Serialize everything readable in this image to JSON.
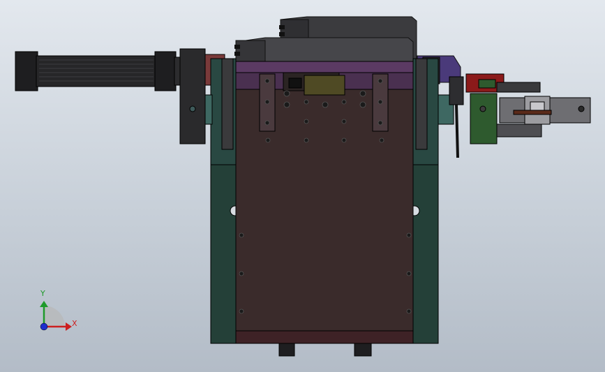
{
  "triad": {
    "x_label": "X",
    "y_label": "Y",
    "colors": {
      "x": "#cc1f1f",
      "y": "#1f9a2a",
      "z": "#1f2fcc"
    }
  },
  "palette": {
    "background_top": "#e3e8ee",
    "background_bottom": "#b3bcc7",
    "main_body": "#3a2b2b",
    "side_blocks": "#2a4a44",
    "purple_trim": "#5b3a63",
    "motor": "#2b2b2d",
    "red_part": "#8b1a1a",
    "green_part": "#2e5a2e",
    "cylinder": "#6e6e72"
  }
}
